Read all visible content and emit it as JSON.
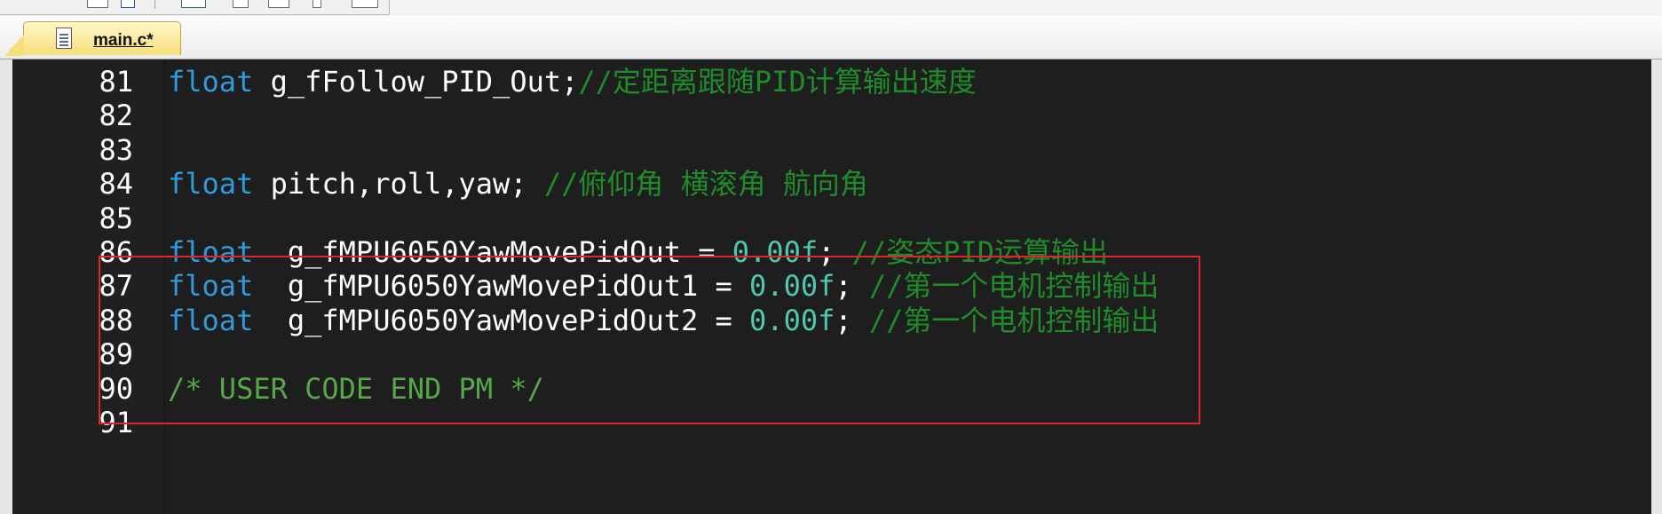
{
  "tab": {
    "filename": "main.c*"
  },
  "toolbar": {
    "icons": [
      "toolbar-icon",
      "toolbar-icon",
      "toolbar-icon",
      "toolbar-icon",
      "toolbar-icon",
      "toolbar-icon"
    ]
  },
  "editor": {
    "colors": {
      "background": "#1e1e1e",
      "keyword": "#2f9bdd",
      "number": "#4ec9b0",
      "comment": "#1f8c2a",
      "highlight_box": "#e0252b"
    },
    "lines": [
      {
        "num": "81",
        "kw": "float",
        "ws1": " ",
        "ident": "g_fFollow_PID_Out;",
        "num_val": "",
        "after": "",
        "comment": "//定距离跟随PID计算输出速度"
      },
      {
        "num": "82",
        "kw": "",
        "ws1": "",
        "ident": "",
        "num_val": "",
        "after": "",
        "comment": ""
      },
      {
        "num": "83",
        "kw": "",
        "ws1": "",
        "ident": "",
        "num_val": "",
        "after": "",
        "comment": ""
      },
      {
        "num": "84",
        "kw": "float",
        "ws1": " ",
        "ident": "pitch,roll,yaw; ",
        "num_val": "",
        "after": "",
        "comment": "//俯仰角 横滚角 航向角"
      },
      {
        "num": "85",
        "kw": "",
        "ws1": "",
        "ident": "",
        "num_val": "",
        "after": "",
        "comment": ""
      },
      {
        "num": "86",
        "kw": "float",
        "ws1": "  ",
        "ident": "g_fMPU6050YawMovePidOut = ",
        "num_val": "0.00f",
        "after": "; ",
        "comment": "//姿态PID运算输出"
      },
      {
        "num": "87",
        "kw": "float",
        "ws1": "  ",
        "ident": "g_fMPU6050YawMovePidOut1 = ",
        "num_val": "0.00f",
        "after": "; ",
        "comment": "//第一个电机控制输出"
      },
      {
        "num": "88",
        "kw": "float",
        "ws1": "  ",
        "ident": "g_fMPU6050YawMovePidOut2 = ",
        "num_val": "0.00f",
        "after": "; ",
        "comment": "//第一个电机控制输出"
      },
      {
        "num": "89",
        "kw": "",
        "ws1": "",
        "ident": "",
        "num_val": "",
        "after": "",
        "comment": ""
      },
      {
        "num": "90",
        "kw": "",
        "ws1": "",
        "ident": "",
        "num_val": "",
        "after": "",
        "comment": "/* USER CODE END PM */"
      },
      {
        "num": "91",
        "kw": "",
        "ws1": "",
        "ident": "",
        "num_val": "",
        "after": "",
        "comment": ""
      }
    ]
  }
}
